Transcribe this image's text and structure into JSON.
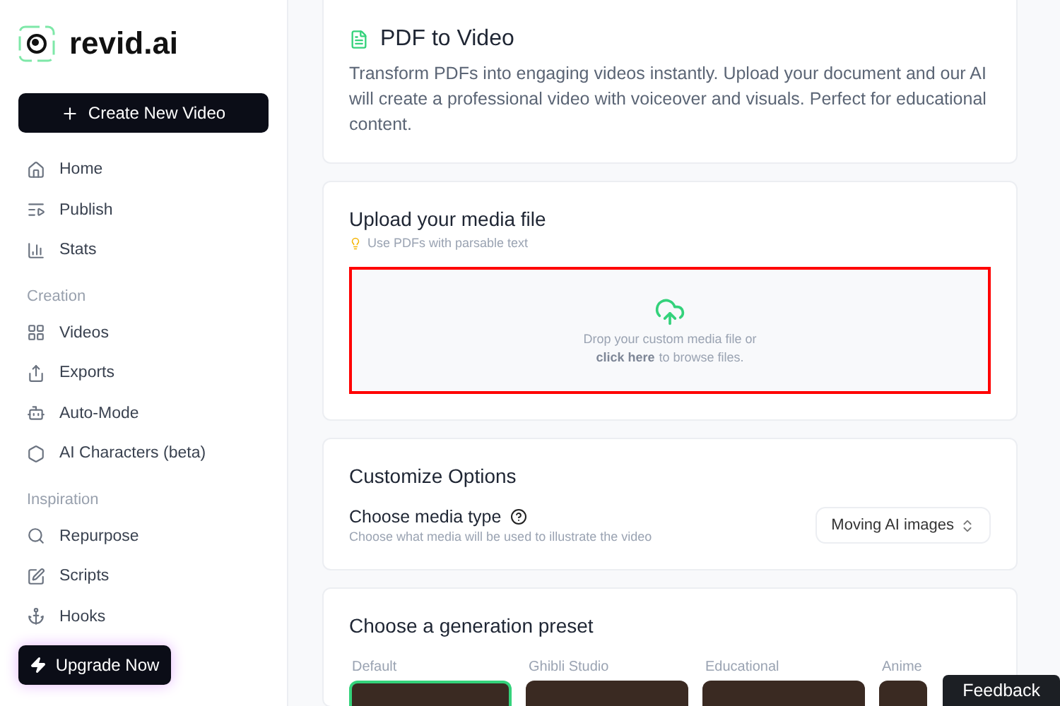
{
  "sidebar": {
    "brand": "revid.ai",
    "create_button": "Create New Video",
    "sections": [
      {
        "items": [
          {
            "label": "Home"
          },
          {
            "label": "Publish"
          },
          {
            "label": "Stats"
          }
        ]
      },
      {
        "title": "Creation",
        "items": [
          {
            "label": "Videos"
          },
          {
            "label": "Exports"
          },
          {
            "label": "Auto-Mode"
          },
          {
            "label": "AI Characters (beta)"
          }
        ]
      },
      {
        "title": "Inspiration",
        "items": [
          {
            "label": "Repurpose"
          },
          {
            "label": "Scripts"
          },
          {
            "label": "Hooks"
          }
        ]
      }
    ],
    "upgrade_button": "Upgrade Now"
  },
  "intro": {
    "title": "PDF to Video",
    "description": "Transform PDFs into engaging videos instantly. Upload your document and our AI will create a professional video with voiceover and visuals. Perfect for educational content."
  },
  "upload": {
    "title": "Upload your media file",
    "hint": "Use PDFs with parsable text",
    "dropzone": {
      "highlighted": true,
      "line_1": "Drop your custom media file or",
      "link": "click here",
      "line_2": "to browse files."
    }
  },
  "options": {
    "title": "Customize Options",
    "media_type": {
      "label": "Choose media type",
      "description": "Choose what media will be used to illustrate the video",
      "value": "Moving AI images"
    }
  },
  "presets": {
    "title": "Choose a generation preset",
    "items": [
      {
        "label": "Default",
        "selected": true
      },
      {
        "label": "Ghibli Studio",
        "selected": false
      },
      {
        "label": "Educational",
        "selected": false
      },
      {
        "label": "Anime",
        "selected": false
      }
    ]
  },
  "feedback_button": "Feedback"
}
